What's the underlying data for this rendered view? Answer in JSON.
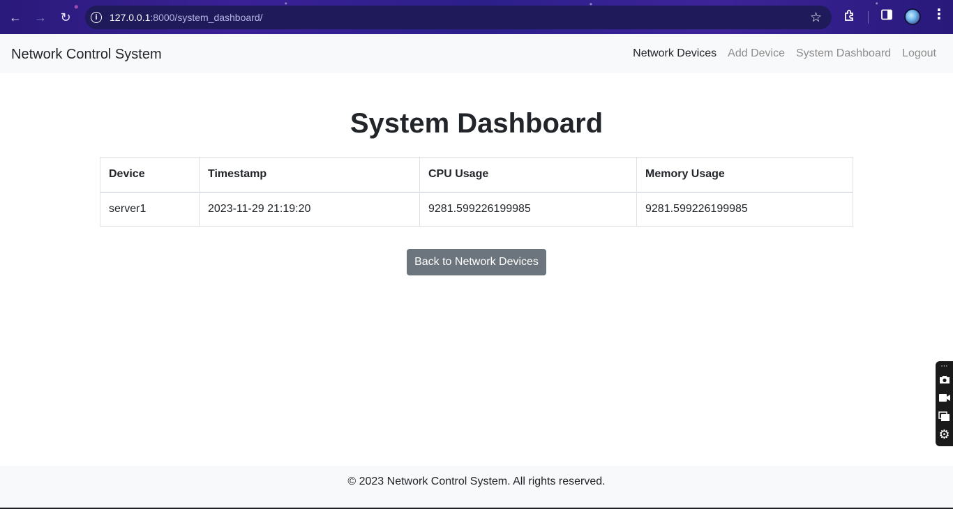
{
  "browser": {
    "url_host": "127.0.0.1",
    "url_rest": ":8000/system_dashboard/",
    "icons": {
      "back": "back-arrow-icon",
      "forward": "forward-arrow-icon",
      "reload": "reload-icon",
      "info": "site-info-icon",
      "star": "bookmark-star-icon",
      "extensions": "extensions-icon",
      "sidepanel": "side-panel-icon",
      "menu": "kebab-menu-icon"
    }
  },
  "navbar": {
    "brand": "Network Control System",
    "links": [
      {
        "label": "Network Devices",
        "active": true
      },
      {
        "label": "Add Device",
        "active": false
      },
      {
        "label": "System Dashboard",
        "active": false
      },
      {
        "label": "Logout",
        "active": false
      }
    ]
  },
  "main": {
    "title": "System Dashboard",
    "table": {
      "headers": [
        "Device",
        "Timestamp",
        "CPU Usage",
        "Memory Usage"
      ],
      "rows": [
        [
          "server1",
          "2023-11-29 21:19:20",
          "9281.599226199985",
          "9281.599226199985"
        ]
      ]
    },
    "back_button": "Back to Network Devices"
  },
  "footer": {
    "text": "© 2023 Network Control System. All rights reserved."
  },
  "capture_toolbar": {
    "icons": [
      "pin-more-icon",
      "camera-icon",
      "video-icon",
      "window-icon",
      "gear-icon"
    ]
  },
  "colors": {
    "navbar_bg": "#f8f9fa",
    "button_secondary": "#6c757d",
    "text_dark": "#212529",
    "link_muted": "#8c8c8c"
  }
}
